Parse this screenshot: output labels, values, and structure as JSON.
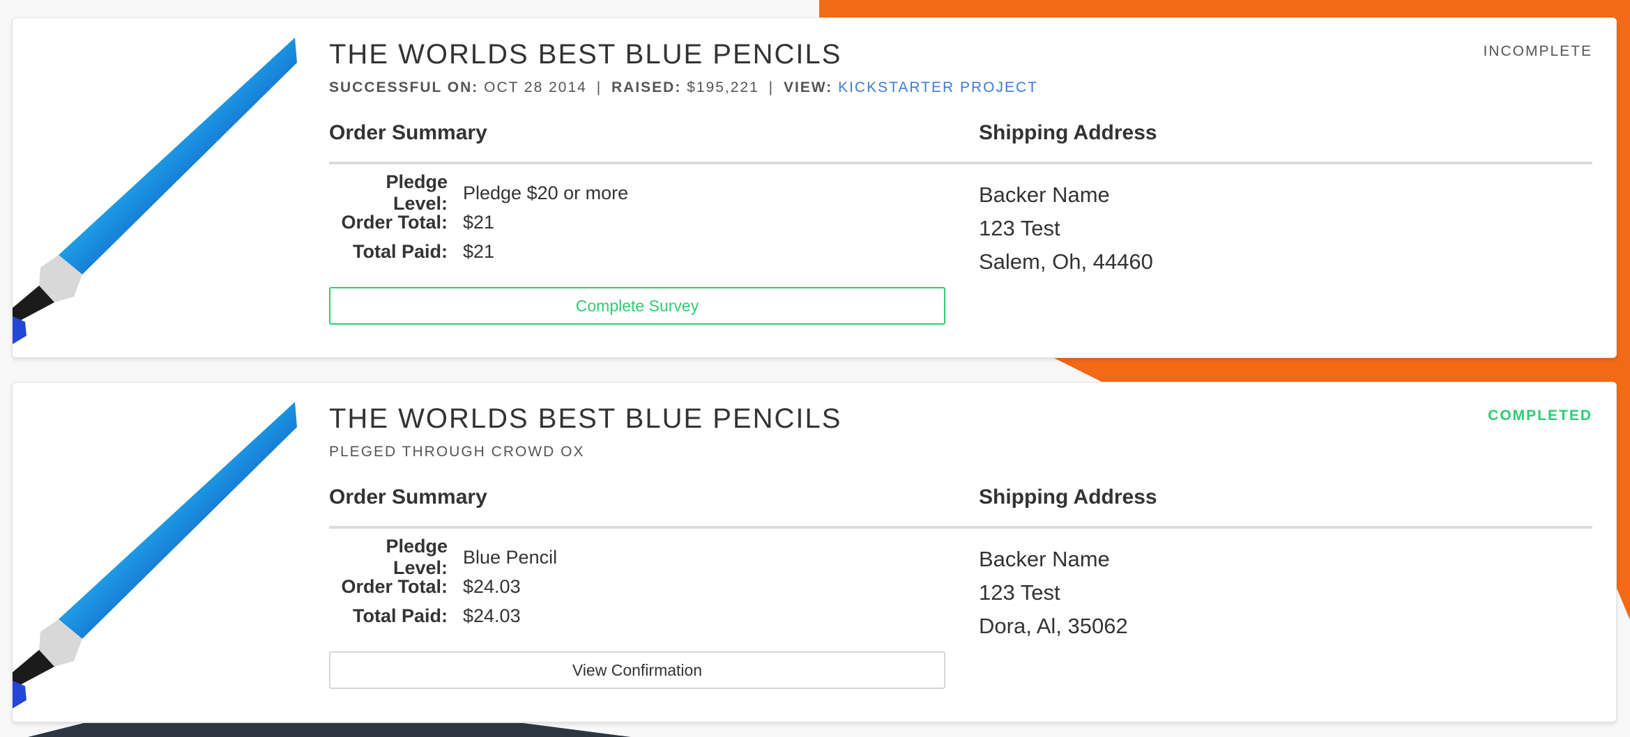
{
  "colors": {
    "accent_orange": "#f26a16",
    "dark_navy": "#2c3742",
    "success_green": "#2ecc71",
    "link_blue": "#3d7bd6"
  },
  "orders": [
    {
      "title": "THE WORLDS BEST BLUE PENCILS",
      "status": "INCOMPLETE",
      "meta": {
        "successful_label": "SUCCESSFUL ON:",
        "successful_value": "OCT 28 2014",
        "raised_label": "RAISED:",
        "raised_value": "$195,221",
        "view_label": "VIEW:",
        "view_link": "KICKSTARTER PROJECT"
      },
      "order_summary_heading": "Order Summary",
      "shipping_heading": "Shipping Address",
      "pledge_level_label": "Pledge Level:",
      "pledge_level": "Pledge $20 or more",
      "order_total_label": "Order Total:",
      "order_total": "$21",
      "total_paid_label": "Total Paid:",
      "total_paid": "$21",
      "address": {
        "name": "Backer Name",
        "street": "123 Test",
        "city": "Salem, Oh, 44460"
      },
      "button_label": "Complete Survey",
      "thumbnail_icon": "blue-pencil-icon"
    },
    {
      "title": "THE WORLDS BEST BLUE PENCILS",
      "status": "COMPLETED",
      "subtitle": "PLEGED THROUGH CROWD OX",
      "order_summary_heading": "Order Summary",
      "shipping_heading": "Shipping Address",
      "pledge_level_label": "Pledge Level:",
      "pledge_level": "Blue Pencil",
      "order_total_label": "Order Total:",
      "order_total": "$24.03",
      "total_paid_label": "Total Paid:",
      "total_paid": "$24.03",
      "address": {
        "name": "Backer Name",
        "street": "123 Test",
        "city": "Dora, Al, 35062"
      },
      "button_label": "View Confirmation",
      "thumbnail_icon": "blue-pencil-icon"
    }
  ]
}
